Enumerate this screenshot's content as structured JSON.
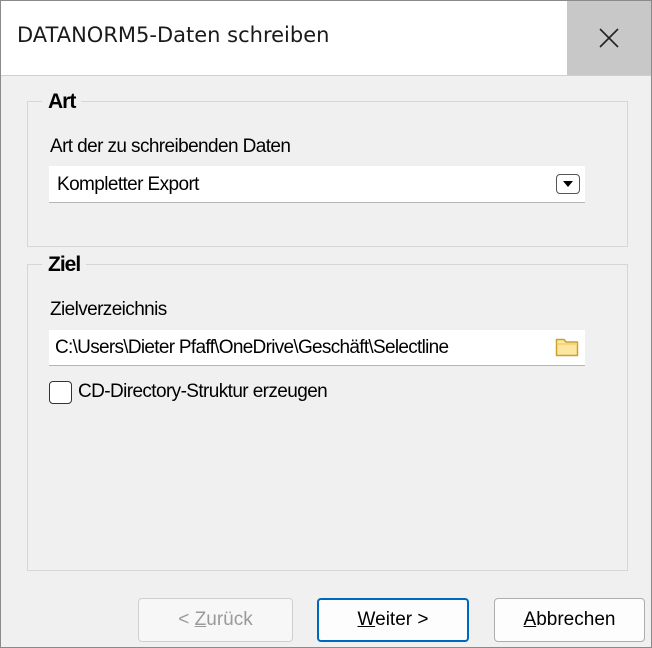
{
  "window": {
    "title": "DATANORM5-Daten schreiben",
    "close_icon": "close-icon"
  },
  "art": {
    "group_title": "Art",
    "field_label": "Art der zu schreibenden Daten",
    "selected_value": "Kompletter Export"
  },
  "ziel": {
    "group_title": "Ziel",
    "field_label": "Zielverzeichnis",
    "path_value": "C:\\Users\\Dieter Pfaff\\OneDrive\\Geschäft\\Selectline",
    "folder_icon": "folder-icon",
    "checkbox_label": "CD-Directory-Struktur erzeugen",
    "checkbox_checked": false
  },
  "buttons": {
    "back_prefix": "< ",
    "back_mnemonic": "Z",
    "back_rest": "urück",
    "next_mnemonic": "W",
    "next_rest": "eiter >",
    "cancel_mnemonic": "A",
    "cancel_rest": "bbrechen"
  },
  "colors": {
    "accent": "#0067c0",
    "dialog_bg": "#f0f0f0",
    "close_bg": "#c8c8c8"
  }
}
